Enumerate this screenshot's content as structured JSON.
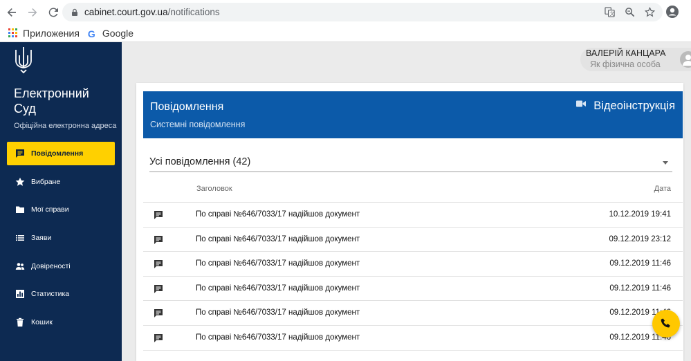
{
  "browser": {
    "url_host": "cabinet.court.gov.ua",
    "url_path": "/notifications",
    "bookmarks": [
      {
        "label": "Приложения",
        "icon": "apps-grid-icon"
      },
      {
        "label": "Google",
        "icon": "google-icon"
      }
    ]
  },
  "sidebar": {
    "brand_line1": "Електронний",
    "brand_line2": "Суд",
    "brand_sub": "Офіційна електронна адреса",
    "items": [
      {
        "label": "Повідомлення",
        "icon": "message-icon",
        "active": true
      },
      {
        "label": "Вибране",
        "icon": "star-icon",
        "active": false
      },
      {
        "label": "Мої справи",
        "icon": "folder-icon",
        "active": false
      },
      {
        "label": "Заяви",
        "icon": "list-icon",
        "active": false
      },
      {
        "label": "Довіреності",
        "icon": "people-icon",
        "active": false
      },
      {
        "label": "Статистика",
        "icon": "chart-icon",
        "active": false
      },
      {
        "label": "Кошик",
        "icon": "trash-icon",
        "active": false
      }
    ]
  },
  "user": {
    "name": "ВАЛЕРІЙ КАНЦАРА",
    "role": "Як фізична особа"
  },
  "card": {
    "title": "Повідомлення",
    "subtitle": "Системні повідомлення",
    "video_label": "Відеоінструкція",
    "filter_value": "Усі повідомлення (42)",
    "columns": {
      "title": "Заголовок",
      "date": "Дата"
    },
    "rows": [
      {
        "title": "По справі №646/7033/17 надійшов документ",
        "date": "10.12.2019 19:41"
      },
      {
        "title": "По справі №646/7033/17 надійшов документ",
        "date": "09.12.2019 23:12"
      },
      {
        "title": "По справі №646/7033/17 надійшов документ",
        "date": "09.12.2019 11:46"
      },
      {
        "title": "По справі №646/7033/17 надійшов документ",
        "date": "09.12.2019 11:46"
      },
      {
        "title": "По справі №646/7033/17 надійшов документ",
        "date": "09.12.2019 11:46"
      },
      {
        "title": "По справі №646/7033/17 надійшов документ",
        "date": "09.12.2019 11:46"
      }
    ]
  },
  "colors": {
    "sidebar_bg": "#0d2a52",
    "active_item": "#ffd000",
    "header_blue": "#0c5aa9",
    "fab": "#ffc800"
  }
}
